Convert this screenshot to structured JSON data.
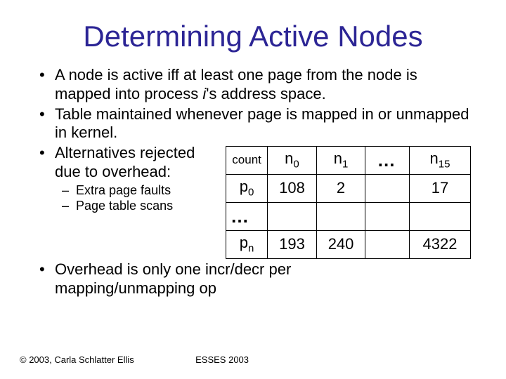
{
  "title": "Determining Active Nodes",
  "bullets": {
    "b1_pre": "A node is active iff at least one page from the node is mapped into process ",
    "b1_it": "i",
    "b1_post": "'s address space.",
    "b2": "Table maintained whenever page is mapped in or unmapped in kernel.",
    "b3": "Alternatives rejected due to overhead:",
    "b3a": "Extra page faults",
    "b3b": "Page table scans",
    "b4": "Overhead is only one incr/decr per mapping/unmapping op"
  },
  "table": {
    "hdr_count": "count",
    "col_n0_n": "n",
    "col_n0_s": "0",
    "col_n1_n": "n",
    "col_n1_s": "1",
    "col_ell": "…",
    "col_n15_n": "n",
    "col_n15_s": "15",
    "row_p0_p": "p",
    "row_p0_s": "0",
    "row_ell_p": "…",
    "row_pn_p": "p",
    "row_pn_s": "n",
    "v_p0_n0": "108",
    "v_p0_n1": "2",
    "v_p0_ell": "",
    "v_p0_n15": "17",
    "v_ell_n0": "",
    "v_ell_n1": "",
    "v_ell_ell": "",
    "v_ell_n15": "",
    "v_pn_n0": "193",
    "v_pn_n1": "240",
    "v_pn_ell": "",
    "v_pn_n15": "4322"
  },
  "footer": {
    "left": "© 2003, Carla Schlatter Ellis",
    "center": "ESSES 2003"
  }
}
